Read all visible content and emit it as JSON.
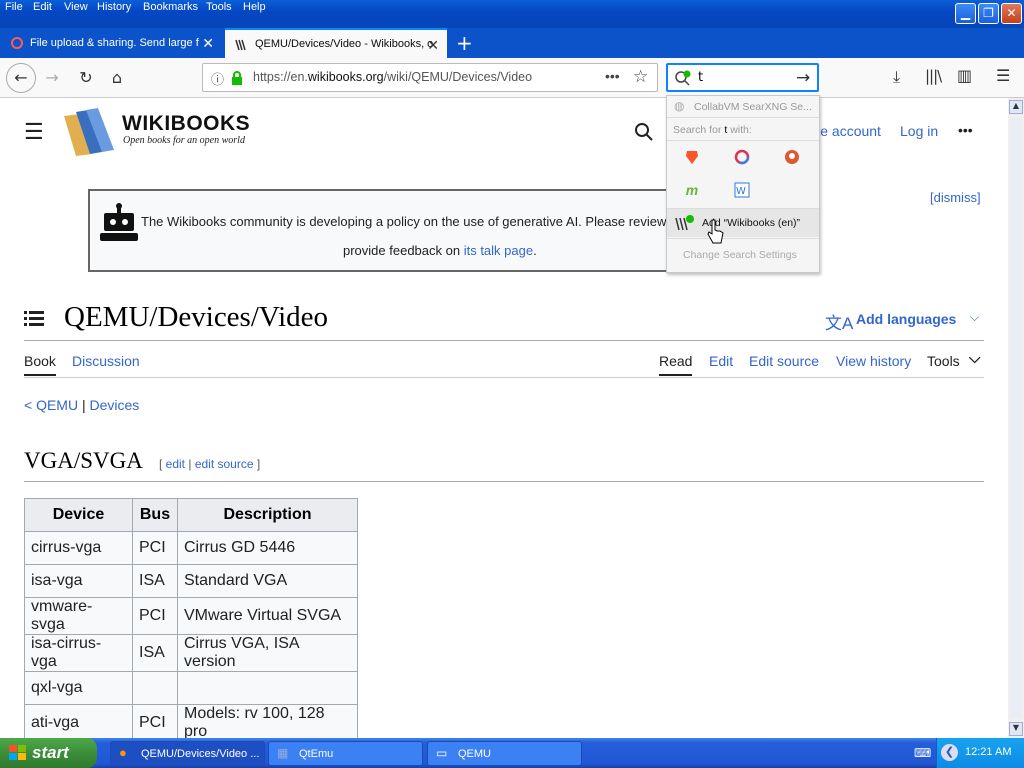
{
  "menu": [
    "File",
    "Edit",
    "View",
    "History",
    "Bookmarks",
    "Tools",
    "Help"
  ],
  "tabs": [
    {
      "title": "File upload & sharing. Send large f",
      "active": false
    },
    {
      "title": "QEMU/Devices/Video - Wikibooks, o",
      "active": true
    }
  ],
  "url": {
    "prefix": "https://en.",
    "domain": "wikibooks.org",
    "path": "/wiki/QEMU/Devices/Video"
  },
  "search": {
    "typed": "t"
  },
  "site": {
    "logo_name": "WIKIBOOKS",
    "tagline": "Open books for an open world",
    "create_account": "Create account",
    "log_in": "Log in",
    "more": "•••"
  },
  "notice": {
    "line1": "The Wikibooks community is developing a policy on the use of generative AI. Please review",
    "line2_prefix": "provide feedback on ",
    "line2_link": "its talk page",
    "line2_suffix": ".",
    "dismiss": "[dismiss]"
  },
  "page": {
    "title": "QEMU/Devices/Video",
    "add_languages": "Add languages",
    "tabs_left": [
      "Book",
      "Discussion"
    ],
    "tabs_right": [
      "Read",
      "Edit",
      "Edit source",
      "View history",
      "Tools"
    ],
    "breadcrumb_prefix": "< ",
    "breadcrumb_qemu": "QEMU",
    "breadcrumb_sep": " | ",
    "breadcrumb_devices": "Devices",
    "section": "VGA/SVGA",
    "section_edit": "edit",
    "section_edit_source": "edit source"
  },
  "table": {
    "headers": [
      "Device",
      "Bus",
      "Description"
    ],
    "rows": [
      [
        "cirrus-vga",
        "PCI",
        "Cirrus GD 5446"
      ],
      [
        "isa-vga",
        "ISA",
        "Standard VGA"
      ],
      [
        "vmware-svga",
        "PCI",
        "VMware Virtual SVGA"
      ],
      [
        "isa-cirrus-vga",
        "ISA",
        "Cirrus VGA, ISA version"
      ],
      [
        "qxl-vga",
        "",
        ""
      ],
      [
        "ati-vga",
        "PCI",
        "Models: rv 100, 128 pro"
      ]
    ]
  },
  "dropdown": {
    "top_engine": "CollabVM SearXNG Se...",
    "search_for_prefix": "Search for ",
    "search_for_term": "t",
    "search_for_suffix": " with:",
    "add_engine": "Add “Wikibooks (en)”",
    "settings": "Change Search Settings"
  },
  "taskbar": {
    "start": "start",
    "items": [
      "QEMU/Devices/Video ...",
      "QtEmu",
      "QEMU"
    ],
    "time": "12:21 AM"
  },
  "colors": {
    "link": "#3366cc",
    "accent": "#0a84ff",
    "xp_blue": "#245edb",
    "start_green": "#3c8d3a"
  }
}
